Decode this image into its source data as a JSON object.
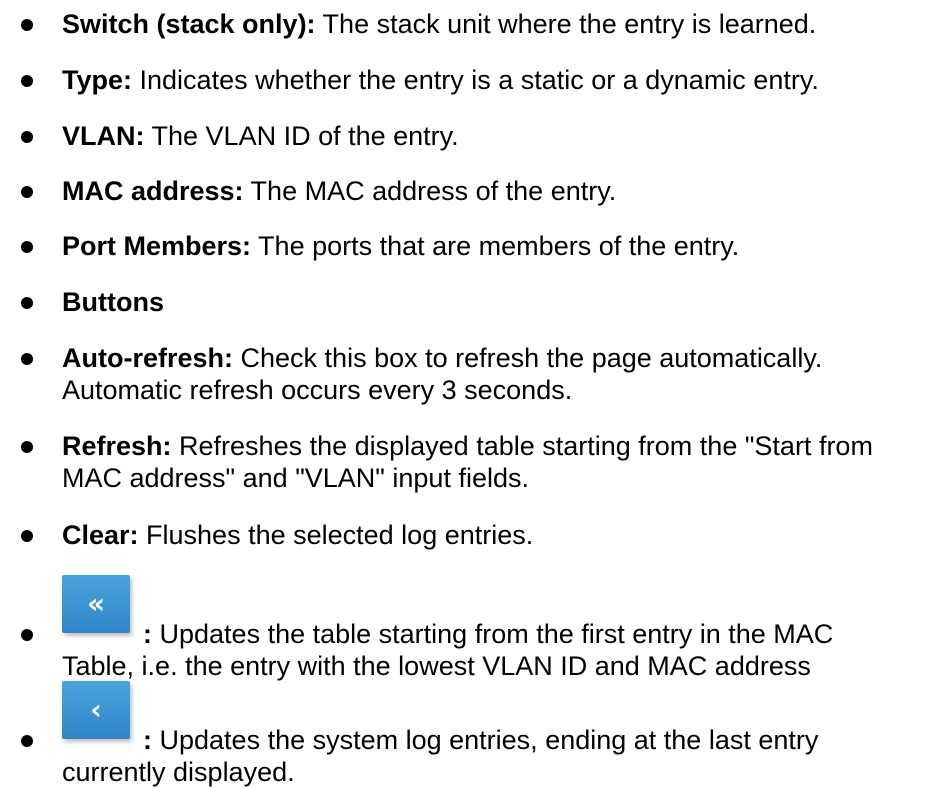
{
  "items": [
    {
      "term": "Switch (stack only):",
      "desc": " The stack unit where the entry is learned."
    },
    {
      "term": "Type:",
      "desc": " Indicates whether the entry is a static or a dynamic entry."
    },
    {
      "term": "VLAN:",
      "desc": " The VLAN ID of the entry."
    },
    {
      "term": "MAC address:",
      "desc": " The MAC address of the entry."
    },
    {
      "term": "Port Members:",
      "desc": " The ports that are members of the entry."
    },
    {
      "term": "Buttons",
      "desc": ""
    },
    {
      "term": "Auto-refresh:",
      "desc": " Check this box to refresh the page automatically.",
      "desc2": "Automatic refresh occurs every 3 seconds."
    },
    {
      "term": "Refresh:",
      "desc": " Refreshes the displayed table starting from the \"Start from",
      "desc2": "MAC address\" and \"VLAN\" input fields."
    },
    {
      "term": "Clear:",
      "desc": " Flushes the selected log entries."
    }
  ],
  "button_items": [
    {
      "icon": "double-chevron-left-icon",
      "glyph": "«",
      "term": ":",
      "desc": " Updates the table starting from the first entry in the MAC",
      "desc2": "Table, i.e. the entry with the lowest VLAN ID and MAC address"
    },
    {
      "icon": "chevron-left-icon",
      "glyph": "‹",
      "term": ":",
      "desc": " Updates the system log entries, ending at the last entry",
      "desc2": "currently displayed."
    }
  ],
  "colors": {
    "button_blue": "#3b95d6",
    "text": "#000000"
  }
}
